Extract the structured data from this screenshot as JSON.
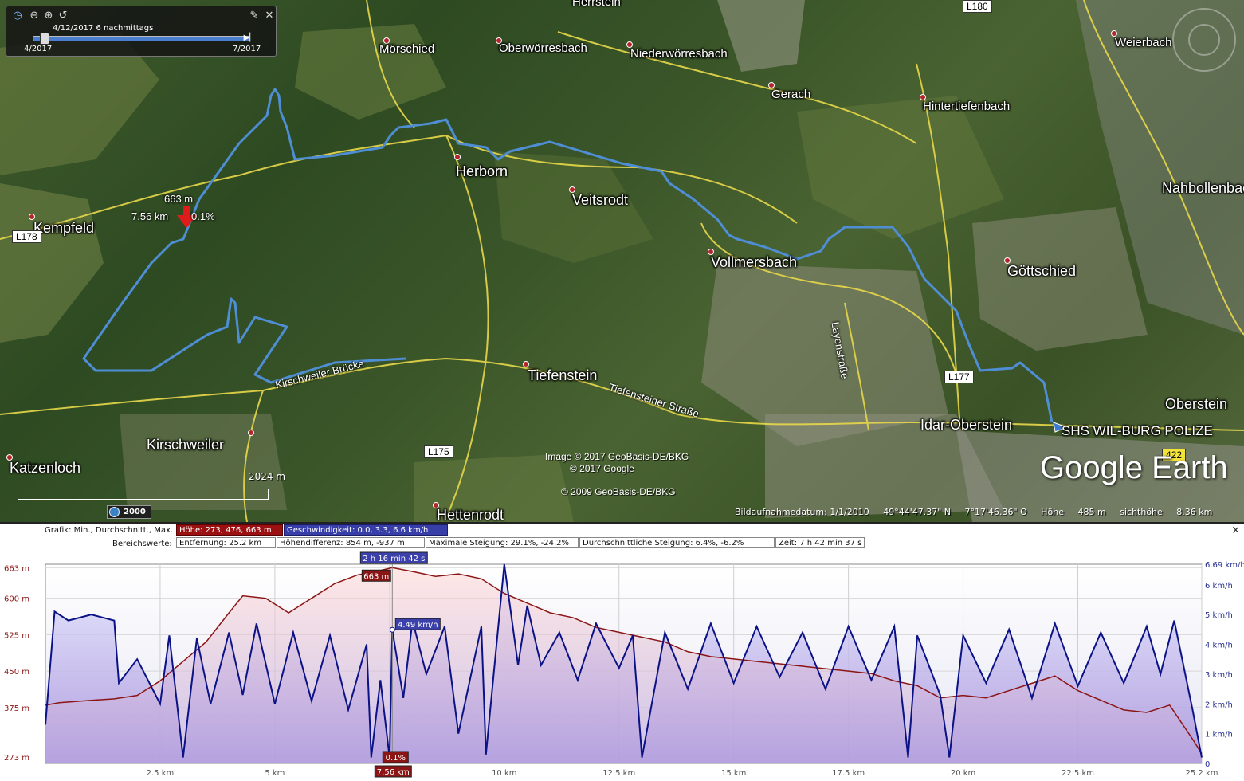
{
  "timeslider": {
    "date": "4/12/2017  6 nachmittags",
    "start": "4/2017",
    "end": "7/2017"
  },
  "map": {
    "places": [
      {
        "name": "Mörschied"
      },
      {
        "name": "Oberwörresbach"
      },
      {
        "name": "Niederwörresbach"
      },
      {
        "name": "Gerach"
      },
      {
        "name": "Hintertiefenbach"
      },
      {
        "name": "Weierbach"
      },
      {
        "name": "Herborn"
      },
      {
        "name": "Veitsrodt"
      },
      {
        "name": "Kempfeld"
      },
      {
        "name": "Vollmersbach"
      },
      {
        "name": "Göttschied"
      },
      {
        "name": "Nahbollenbac"
      },
      {
        "name": "Tiefenstein"
      },
      {
        "name": "Idar-Oberstein"
      },
      {
        "name": "Oberstein"
      },
      {
        "name": "Kirschweiler"
      },
      {
        "name": "Katzenloch"
      },
      {
        "name": "Hettenrodt"
      },
      {
        "name": "Herrstein"
      }
    ],
    "road_signs": [
      "L178",
      "L175",
      "L177",
      "422",
      "L180"
    ],
    "road_labels": [
      "Kirschweiler Brücke",
      "Tiefensteiner Straße",
      "Layenstraße"
    ],
    "poi_label": "SHS WIL-BURG POLIZE",
    "marker": {
      "elevation": "663 m",
      "distance": "7.56 km",
      "grade": "0.1%"
    },
    "credits": {
      "image": "Image © 2017 GeoBasis-DE/BKG",
      "google": "© 2017 Google",
      "basis": "© 2009 GeoBasis-DE/BKG",
      "brand": "Google Earth"
    },
    "scale": "2024  m",
    "year": "2000",
    "status": {
      "date": "Bildaufnahmedatum: 1/1/2010",
      "lat": "49°44'47.37\" N",
      "lon": "7°17'46.36\" O",
      "elev_label": "Höhe",
      "elev": "485 m",
      "eye_label": "sichthöhe",
      "eye": "8.36 km"
    }
  },
  "profile": {
    "graph_label": "Grafik: Min., Durchschnitt., Max.",
    "elev_stats": "Höhe: 273, 476, 663 m",
    "speed_stats": "Geschwindigkeit: 0.0, 3.3, 6.6 km/h",
    "range_label": "Bereichswerte:",
    "distance": "Entfernung: 25.2 km",
    "elev_diff": "Höhendifferenz: 854 m, -937 m",
    "max_slope": "Maximale Steigung: 29.1%, -24.2%",
    "avg_slope": "Durchschnittliche Steigung: 6.4%, -6.2%",
    "time": "Zeit: 7 h 42 min 37 s",
    "cursor_time": "2 h 16 min 42 s",
    "cursor_elev": "663 m",
    "cursor_speed": "4.49 km/h",
    "cursor_grade": "0.1%",
    "cursor_dist": "7.56 km",
    "close": "×"
  },
  "chart_data": {
    "type": "line",
    "x_ticks": [
      "2.5 km",
      "5 km",
      "7.5 km",
      "10 km",
      "12.5 km",
      "15 km",
      "17.5 km",
      "20 km",
      "22.5 km",
      "25.2 km"
    ],
    "x_tick_values": [
      2.5,
      5,
      7.5,
      10,
      12.5,
      15,
      17.5,
      20,
      22.5,
      25.2
    ],
    "y_left_ticks": [
      "663 m",
      "600 m",
      "525 m",
      "450 m",
      "375 m",
      "273 m"
    ],
    "y_left_values": [
      663,
      600,
      525,
      450,
      375,
      273
    ],
    "y_right_ticks": [
      "6.69 km/h",
      "6 km/h",
      "5 km/h",
      "4 km/h",
      "3 km/h",
      "2 km/h",
      "1 km/h",
      "0"
    ],
    "y_right_values": [
      6.69,
      6,
      5,
      4,
      3,
      2,
      1,
      0
    ],
    "xlim": [
      0,
      25.2
    ],
    "ylim_left": [
      260,
      670
    ],
    "ylim_right": [
      0,
      6.69
    ],
    "series": [
      {
        "name": "Höhe",
        "color": "#8b1414",
        "x": [
          0,
          0.3,
          1,
          1.5,
          2,
          2.5,
          3,
          3.5,
          4,
          4.3,
          4.8,
          5.3,
          5.8,
          6.3,
          6.8,
          7.2,
          7.56,
          8,
          8.5,
          9,
          9.5,
          10,
          10.5,
          11,
          11.5,
          12,
          12.5,
          13,
          13.5,
          14,
          14.5,
          15,
          15.5,
          16,
          16.5,
          17,
          17.5,
          18,
          18.5,
          19,
          19.5,
          20,
          20.5,
          21,
          21.5,
          22,
          22.5,
          23,
          23.5,
          24,
          24.5,
          25,
          25.2
        ],
        "y": [
          380,
          385,
          390,
          393,
          400,
          430,
          470,
          510,
          570,
          605,
          600,
          570,
          600,
          630,
          648,
          655,
          663,
          655,
          645,
          650,
          640,
          610,
          590,
          570,
          560,
          540,
          530,
          520,
          510,
          490,
          480,
          475,
          470,
          465,
          460,
          455,
          450,
          445,
          430,
          420,
          395,
          400,
          395,
          410,
          425,
          440,
          410,
          390,
          370,
          365,
          380,
          310,
          280
        ]
      },
      {
        "name": "Geschwindigkeit",
        "color": "#0b1285",
        "x": [
          0,
          0.2,
          0.5,
          1,
          1.5,
          1.6,
          2,
          2.5,
          2.7,
          3,
          3.3,
          3.6,
          4,
          4.3,
          4.6,
          5,
          5.4,
          5.8,
          6.2,
          6.6,
          7,
          7.1,
          7.3,
          7.5,
          7.56,
          7.8,
          8,
          8.3,
          8.7,
          9,
          9.5,
          9.6,
          10,
          10.3,
          10.5,
          10.8,
          11.2,
          11.6,
          12,
          12.5,
          12.8,
          13,
          13.5,
          14,
          14.5,
          15,
          15.5,
          16,
          16.5,
          17,
          17.5,
          18,
          18.5,
          18.8,
          19,
          19.5,
          19.7,
          20,
          20.5,
          21,
          21.5,
          22,
          22.5,
          23,
          23.5,
          24,
          24.3,
          24.6,
          25,
          25.2
        ],
        "y": [
          1.3,
          5.1,
          4.8,
          5.0,
          4.8,
          2.7,
          3.5,
          2.0,
          4.3,
          0.2,
          4.2,
          2.0,
          4.4,
          2.3,
          4.7,
          2.0,
          4.4,
          2.1,
          4.3,
          1.8,
          4.0,
          0.2,
          2.8,
          0.2,
          4.49,
          2.2,
          4.8,
          3.0,
          4.6,
          1.0,
          4.6,
          0.3,
          6.69,
          3.3,
          5.3,
          3.3,
          4.4,
          2.8,
          4.7,
          3.2,
          4.3,
          0.2,
          4.4,
          2.5,
          4.7,
          2.7,
          4.6,
          2.9,
          4.4,
          2.5,
          4.6,
          2.8,
          4.6,
          0.2,
          4.3,
          2.3,
          0.2,
          4.3,
          2.7,
          4.5,
          2.2,
          4.7,
          2.6,
          4.4,
          2.7,
          4.6,
          3.0,
          4.8,
          1.8,
          0.2
        ]
      }
    ],
    "cursor_x": 7.56
  }
}
